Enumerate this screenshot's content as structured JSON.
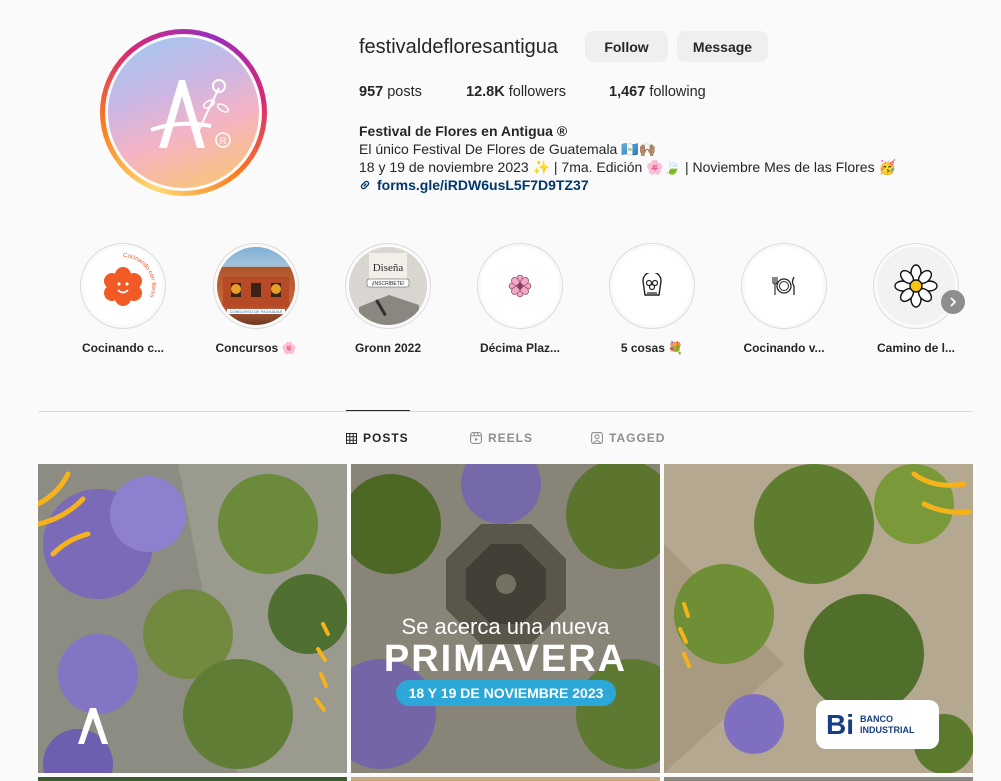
{
  "profile": {
    "username": "festivaldefloresantigua",
    "follow_label": "Follow",
    "message_label": "Message",
    "stats": {
      "posts_count": "957",
      "posts_label": "posts",
      "followers_count": "12.8K",
      "followers_label": "followers",
      "following_count": "1,467",
      "following_label": "following"
    },
    "bio": {
      "name": "Festival de Flores en Antigua ®",
      "line1": "El único Festival De Flores de Guatemala 🇬🇹🙌🏽",
      "line2": "18 y 19 de noviembre 2023 ✨ | 7ma. Edición 🌸🍃 | Noviembre Mes de las Flores 🥳",
      "link": "forms.gle/iRDW6usL5F7D9TZ37"
    },
    "colors": {
      "link": "#00376b",
      "button_bg": "#efefef"
    }
  },
  "highlights": [
    {
      "label": "Cocinando c...",
      "icon": "smiling-flower-icon"
    },
    {
      "label": "Concursos 🌸",
      "icon": "building-photo"
    },
    {
      "label": "Gronn 2022",
      "icon": "design-poster-photo"
    },
    {
      "label": "Décima Plaz...",
      "icon": "flower-icon"
    },
    {
      "label": "5 cosas 💐",
      "icon": "bouquet-line-icon"
    },
    {
      "label": "Cocinando v...",
      "icon": "plate-cutlery-icon"
    },
    {
      "label": "Camino de l...",
      "icon": "daisy-icon"
    }
  ],
  "highlight_art": {
    "ring_text": "Cocinando con flores",
    "poster_title": "Diseña",
    "poster_cta": "¡INSCRÍBETE!",
    "building_sign": "CONCURSO DE FACHADAS"
  },
  "tabs": [
    {
      "label": "POSTS",
      "icon": "grid-icon",
      "active": true
    },
    {
      "label": "REELS",
      "icon": "reels-icon",
      "active": false
    },
    {
      "label": "TAGGED",
      "icon": "tagged-icon",
      "active": false
    }
  ],
  "posts": {
    "promo_sub": "Se acerca una nueva",
    "promo_main": "PRIMAVERA",
    "promo_date": "18 Y 19 DE NOVIEMBRE 2023",
    "bank_logo": "Bi",
    "bank_name_1": "BANCO",
    "bank_name_2": "INDUSTRIAL"
  }
}
